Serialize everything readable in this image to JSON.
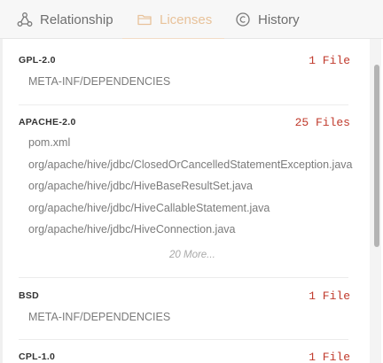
{
  "tabs": [
    {
      "label": "Relationship",
      "icon": "relationship-icon",
      "active": false
    },
    {
      "label": "Licenses",
      "icon": "folder-icon",
      "active": true
    },
    {
      "label": "History",
      "icon": "history-icon",
      "active": false
    }
  ],
  "colors": {
    "accent": "#e8c29a",
    "count": "#c0392b",
    "muted_text": "#7b7b7b"
  },
  "licenses": [
    {
      "name": "GPL-2.0",
      "count": "1 File",
      "files": [
        "META-INF/DEPENDENCIES"
      ]
    },
    {
      "name": "APACHE-2.0",
      "count": "25 Files",
      "files": [
        "pom.xml",
        "org/apache/hive/jdbc/ClosedOrCancelledStatementException.java",
        "org/apache/hive/jdbc/HiveBaseResultSet.java",
        "org/apache/hive/jdbc/HiveCallableStatement.java",
        "org/apache/hive/jdbc/HiveConnection.java"
      ],
      "more": "20 More..."
    },
    {
      "name": "BSD",
      "count": "1 File",
      "files": [
        "META-INF/DEPENDENCIES"
      ]
    },
    {
      "name": "CPL-1.0",
      "count": "1 File",
      "files": []
    }
  ]
}
